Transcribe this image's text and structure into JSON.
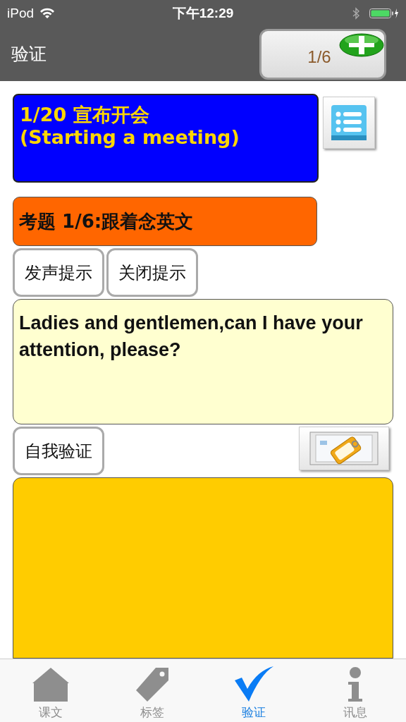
{
  "status_bar": {
    "carrier": "iPod",
    "time": "下午12:29"
  },
  "nav_bar": {
    "title": "验证",
    "counter": "1/6"
  },
  "lesson": {
    "number": "1/20 宣布开会",
    "subtitle": "(Starting a meeting)"
  },
  "question": {
    "label": "考题 1/6:跟着念英文"
  },
  "hint_buttons": [
    "发声提示",
    "关闭提示"
  ],
  "sentence": {
    "text": "Ladies and gentlemen,can I have your attention, please?"
  },
  "self_check_button": "自我验证",
  "tabs": [
    {
      "label": "课文",
      "kind": "home",
      "selected": false
    },
    {
      "label": "标签",
      "kind": "tag",
      "selected": false
    },
    {
      "label": "验证",
      "kind": "check",
      "selected": true
    },
    {
      "label": "讯息",
      "kind": "info",
      "selected": false
    }
  ]
}
